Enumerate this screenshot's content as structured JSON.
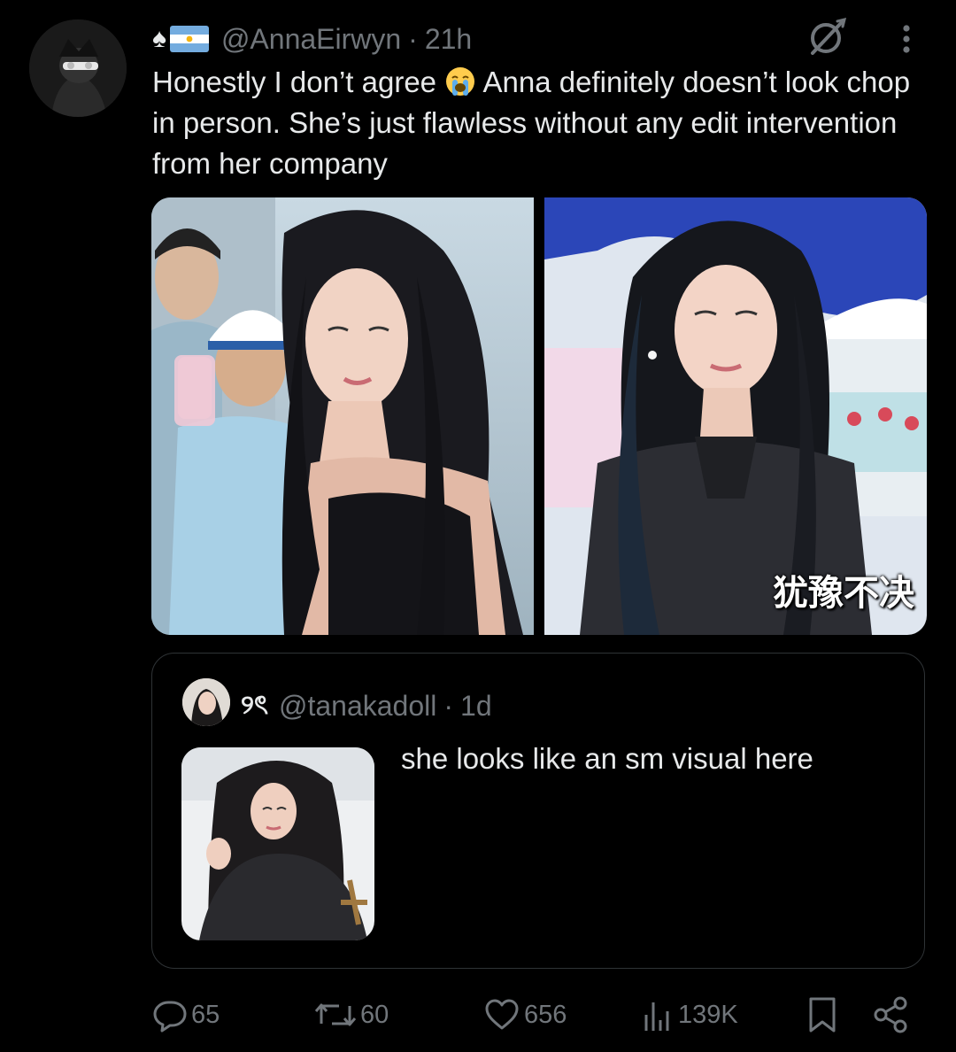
{
  "tweet": {
    "badge_emoji": "♠",
    "handle": "@AnnaEirwyn",
    "separator": "·",
    "time": "21h",
    "text_part1": "Honestly I don’t agree ",
    "text_part2": " Anna definitely doesn’t look chop in person. She’s just flawless without any edit intervention from her company",
    "media": [
      {
        "caption": ""
      },
      {
        "caption": "犹豫不决"
      }
    ]
  },
  "quote": {
    "name": "୨ৎ",
    "handle": "@tanakadoll",
    "separator": "·",
    "time": "1d",
    "text": "she looks like an sm visual here"
  },
  "actions": {
    "replies": "65",
    "reposts": "60",
    "likes": "656",
    "views": "139K"
  },
  "colors": {
    "background": "#000000",
    "text_primary": "#e7e9ea",
    "text_secondary": "#71767b",
    "border": "#2f3336"
  },
  "icons": {
    "reply": "reply-icon",
    "repost": "repost-icon",
    "like": "heart-icon",
    "views": "views-icon",
    "bookmark": "bookmark-icon",
    "share": "share-icon",
    "grok": "grok-icon",
    "more": "more-icon"
  }
}
